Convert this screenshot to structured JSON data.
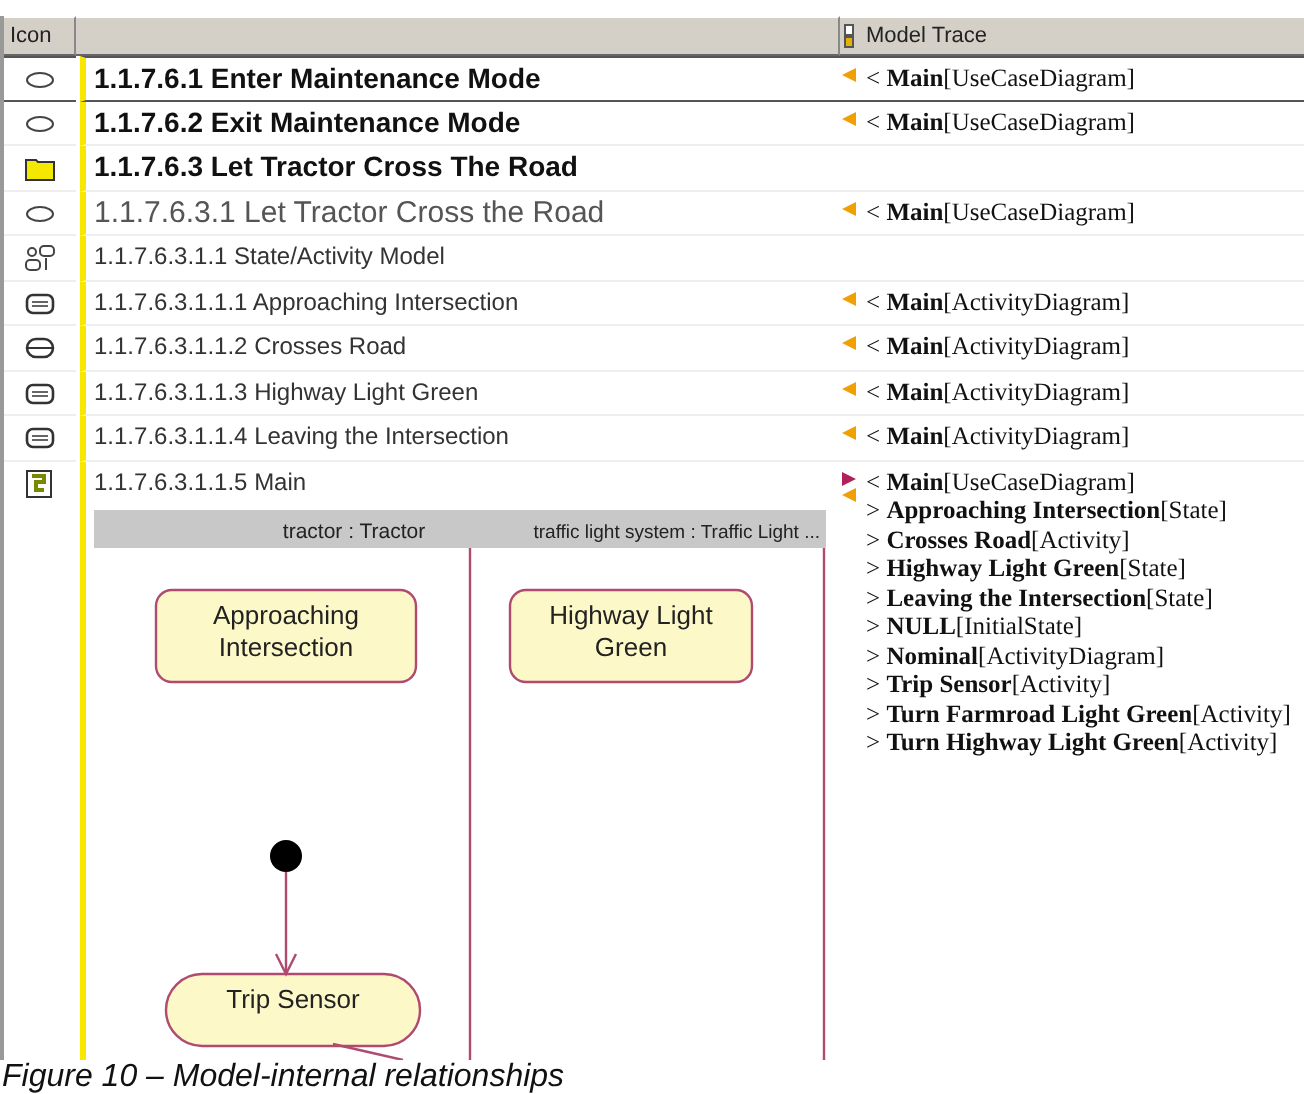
{
  "table": {
    "columns": [
      {
        "label": "Icon"
      },
      {
        "label": "Model Trace"
      }
    ],
    "rows": [
      {
        "kind": "use-case",
        "label": "1.1.7.6.1 Enter Maintenance Mode",
        "selected": true,
        "outgoing": false,
        "incoming": true,
        "trace": [
          "< **Main**[UseCaseDiagram]"
        ]
      },
      {
        "kind": "use-case",
        "label": "1.1.7.6.2 Exit Maintenance Mode",
        "selected": false,
        "outgoing": false,
        "incoming": true,
        "trace": [
          "< **Main**[UseCaseDiagram]"
        ]
      },
      {
        "kind": "folder",
        "label": "1.1.7.6.3 Let Tractor Cross The Road",
        "selected": false,
        "outgoing": false,
        "incoming": false,
        "children": [
          {
            "kind": "use-case",
            "label": "1.1.7.6.3.1 Let Tractor Cross the Road",
            "selected": false,
            "outgoing": false,
            "incoming": true,
            "trace": [
              "< **Main**[UseCaseDiagram]"
            ],
            "children": [
              {
                "kind": "model",
                "label": "1.1.7.6.3.1.1 State/Activity Model",
                "selected": false,
                "outgoing": false,
                "incoming": false,
                "children": [
                  {
                    "kind": "state",
                    "label": "1.1.7.6.3.1.1.1 Approaching Intersection",
                    "selected": false,
                    "outgoing": false,
                    "incoming": true,
                    "trace": [
                      "< **Main**[ActivityDiagram]"
                    ]
                  },
                  {
                    "kind": "activity",
                    "label": "1.1.7.6.3.1.1.2 Crosses Road",
                    "selected": false,
                    "outgoing": false,
                    "incoming": true,
                    "trace": [
                      "< **Main**[ActivityDiagram]"
                    ]
                  },
                  {
                    "kind": "state",
                    "label": "1.1.7.6.3.1.1.3 Highway Light Green",
                    "selected": false,
                    "outgoing": false,
                    "incoming": true,
                    "trace": [
                      "< **Main**[ActivityDiagram]"
                    ]
                  },
                  {
                    "kind": "state",
                    "label": "1.1.7.6.3.1.1.4 Leaving the Intersection",
                    "selected": false,
                    "outgoing": false,
                    "incoming": true,
                    "trace": [
                      "< **Main**[ActivityDiagram]"
                    ]
                  },
                  {
                    "kind": "diagram",
                    "label": "1.1.7.6.3.1.1.5 Main",
                    "selected": false,
                    "outgoing": true,
                    "incoming": true,
                    "trace": [
                      "< **Main**[UseCaseDiagram]",
                      "> **Approaching Intersection**[State]",
                      "> **Crosses Road**[Activity]",
                      "> **Highway Light Green**[State]",
                      "> **Leaving the Intersection**[State]",
                      "> **NULL**[InitialState]",
                      "> **Nominal**[ActivityDiagram]",
                      "> **Trip Sensor**[Activity]",
                      "> **Turn Farmroad Light Green**[Activity]",
                      "> **Turn Highway Light Green**[Activity]"
                    ],
                    "diagram": {
                      "lanes": [
                        {
                          "label": "tractor : Tractor"
                        },
                        {
                          "label": "traffic light system : Traffic Light ..."
                        }
                      ],
                      "nodes": [
                        {
                          "kind": "state",
                          "lines": [
                            "Approaching",
                            "Intersection"
                          ]
                        },
                        {
                          "kind": "state",
                          "lines": [
                            "Highway Light",
                            "Green"
                          ]
                        },
                        {
                          "kind": "initial"
                        },
                        {
                          "kind": "activity",
                          "lines": [
                            "Trip Sensor"
                          ]
                        }
                      ],
                      "edges": [
                        {
                          "kind": "arrow"
                        },
                        {
                          "kind": "stub"
                        }
                      ]
                    }
                  }
                ]
              }
            ]
          }
        ]
      }
    ]
  },
  "caption": "Figure 10 – Model-internal relationships"
}
